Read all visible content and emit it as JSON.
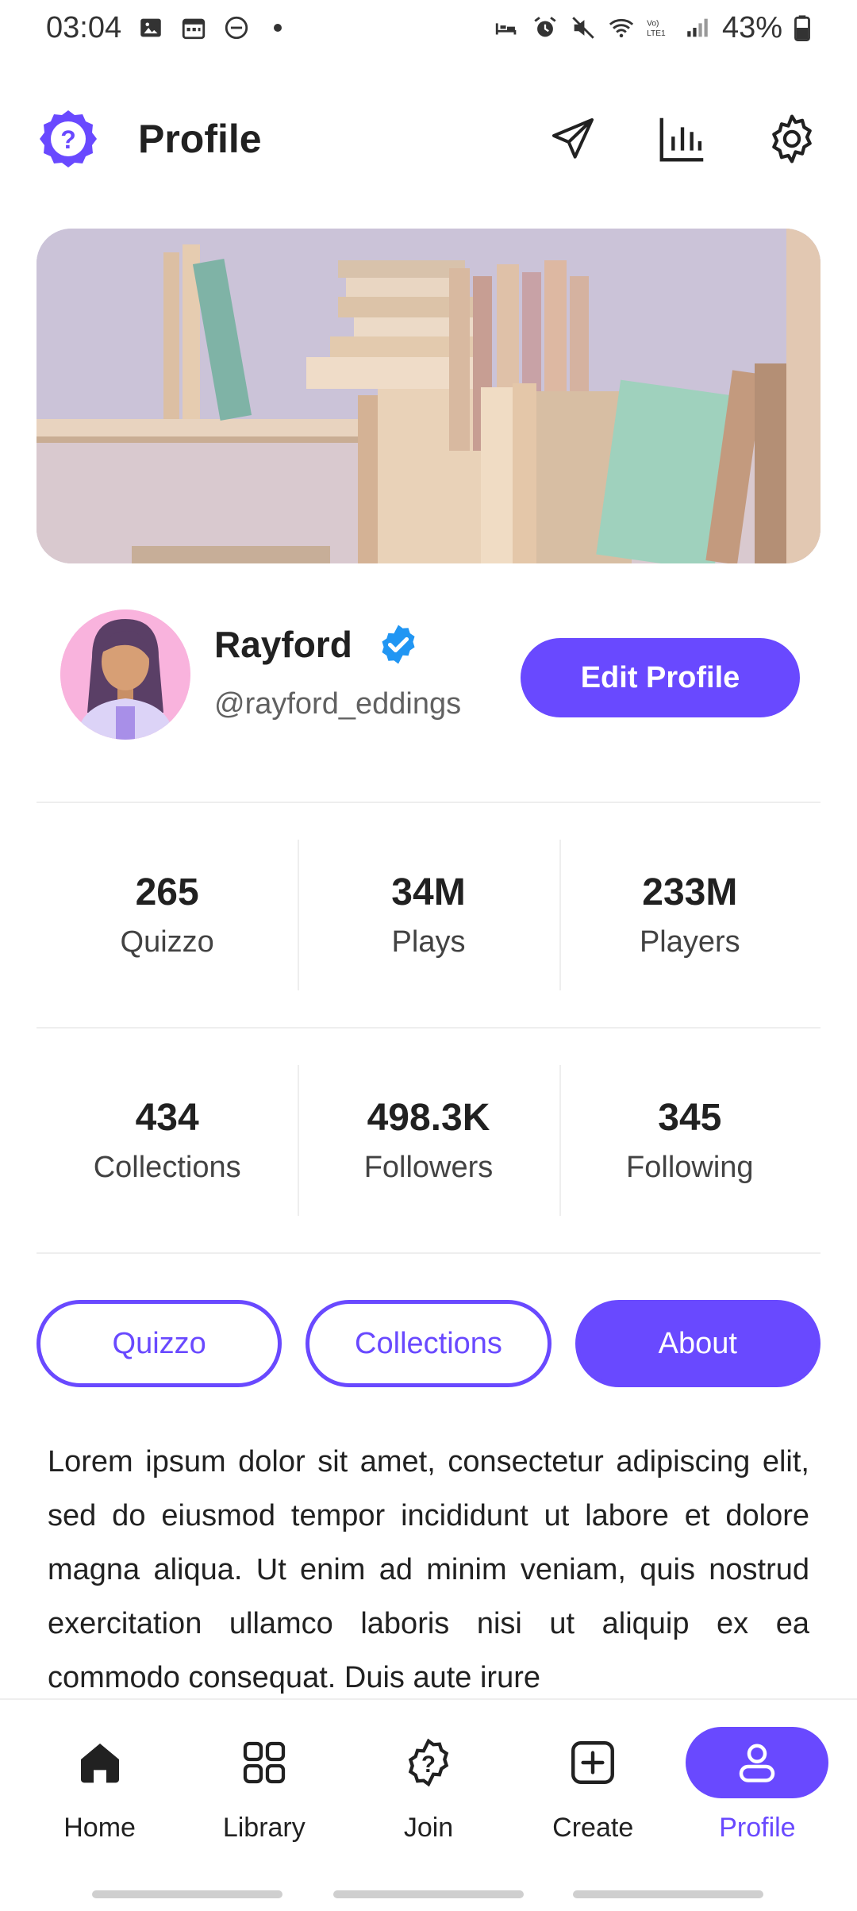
{
  "status_bar": {
    "time": "03:04",
    "battery": "43%"
  },
  "header": {
    "title": "Profile"
  },
  "profile": {
    "name": "Rayford",
    "username": "@rayford_eddings",
    "edit_label": "Edit Profile"
  },
  "stats_row1": [
    {
      "value": "265",
      "label": "Quizzo"
    },
    {
      "value": "34M",
      "label": "Plays"
    },
    {
      "value": "233M",
      "label": "Players"
    }
  ],
  "stats_row2": [
    {
      "value": "434",
      "label": "Collections"
    },
    {
      "value": "498.3K",
      "label": "Followers"
    },
    {
      "value": "345",
      "label": "Following"
    }
  ],
  "tabs": [
    {
      "label": "Quizzo"
    },
    {
      "label": "Collections"
    },
    {
      "label": "About"
    }
  ],
  "about": {
    "text": "Lorem ipsum dolor sit amet, consectetur adipiscing elit, sed do eiusmod tempor incididunt ut labore et dolore magna aliqua. Ut enim ad minim veniam, quis nostrud exercitation ullamco laboris nisi ut aliquip ex ea commodo consequat. Duis aute irure"
  },
  "bottom_nav": [
    {
      "label": "Home",
      "icon": "home-icon"
    },
    {
      "label": "Library",
      "icon": "grid-icon"
    },
    {
      "label": "Join",
      "icon": "quiz-badge-icon"
    },
    {
      "label": "Create",
      "icon": "plus-square-icon"
    },
    {
      "label": "Profile",
      "icon": "user-icon"
    }
  ],
  "colors": {
    "accent": "#6949ff",
    "verified": "#2196f3"
  }
}
